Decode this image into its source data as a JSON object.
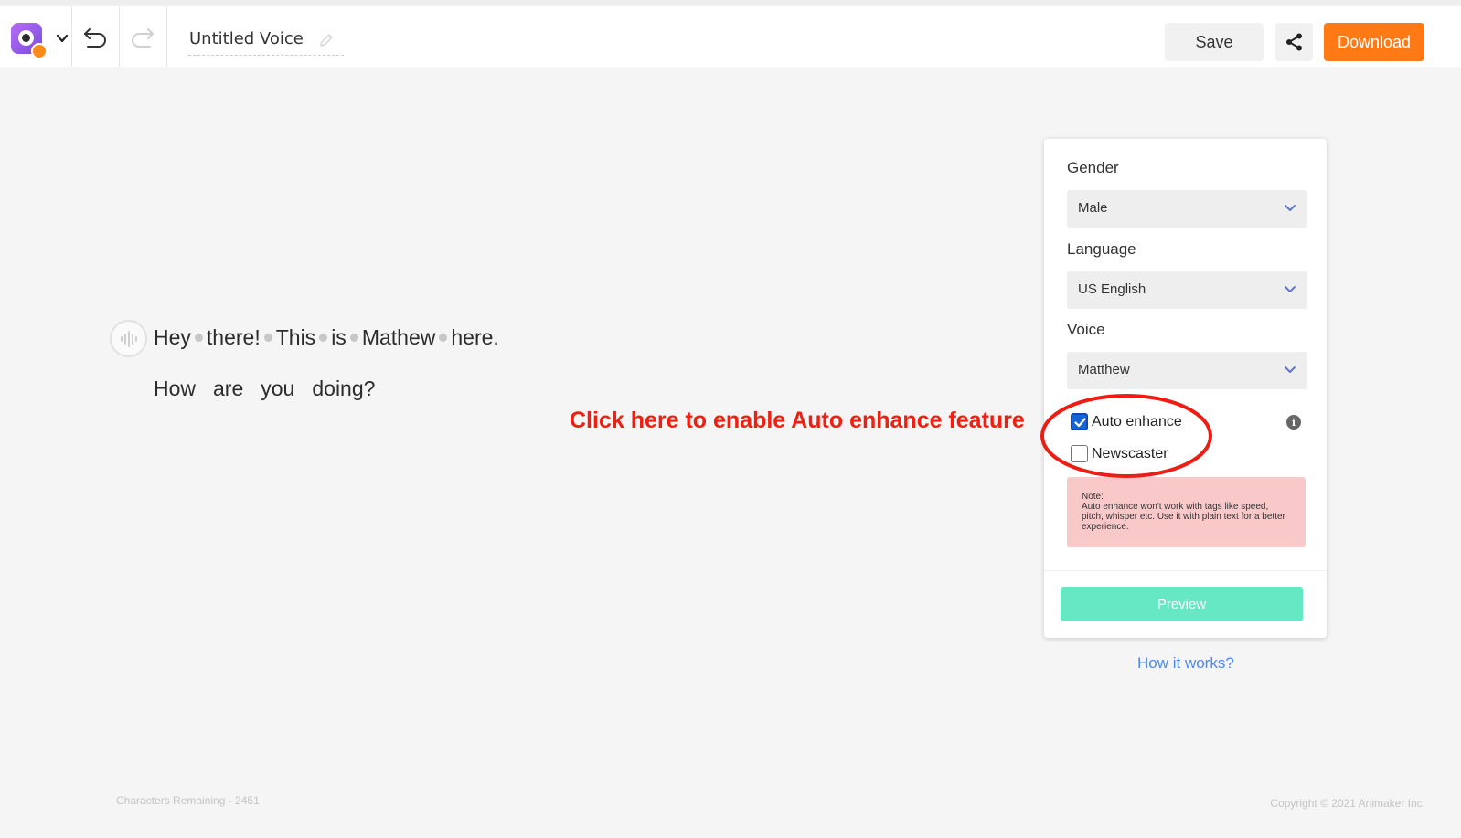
{
  "header": {
    "document_title": "Untitled Voice",
    "save_label": "Save",
    "download_label": "Download",
    "accent_color": "#ff7a15",
    "icons": {
      "logo": "animaker-voice-logo-icon",
      "menu": "chevron-down-icon",
      "undo": "undo-icon",
      "redo": "redo-icon",
      "edit": "pencil-icon",
      "share": "share-icon"
    }
  },
  "editor": {
    "line1_words": [
      "Hey",
      "there!",
      "This",
      "is",
      "Mathew",
      "here."
    ],
    "line2_words": [
      "How",
      "are",
      "you",
      "doing?"
    ],
    "play_icon": "waveform-icon"
  },
  "annotation": {
    "text": "Click here to enable Auto enhance feature",
    "color": "#f01f12"
  },
  "settings": {
    "gender": {
      "label": "Gender",
      "value": "Male"
    },
    "language": {
      "label": "Language",
      "value": "US English"
    },
    "voice": {
      "label": "Voice",
      "value": "Matthew"
    },
    "auto_enhance": {
      "label": "Auto enhance",
      "checked": true
    },
    "newscaster": {
      "label": "Newscaster",
      "checked": false
    },
    "info_icon": "info-icon",
    "note": {
      "title": "Note:",
      "body": "Auto enhance won't work with tags like speed, pitch, whisper etc. Use it with plain text for a better experience."
    },
    "preview_label": "Preview",
    "preview_color": "#67e8c5"
  },
  "how_it_works": "How it works?",
  "footer": {
    "characters_remaining": "Characters Remaining - 2451",
    "copyright": "Copyright © 2021 Animaker Inc."
  }
}
